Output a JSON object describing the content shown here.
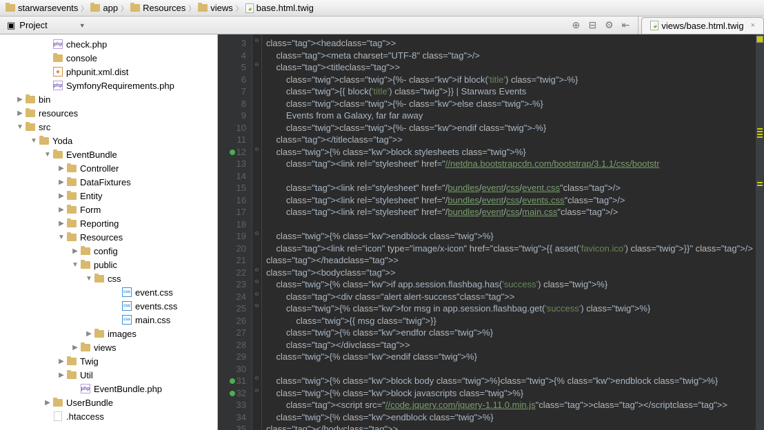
{
  "breadcrumb": [
    {
      "label": "starwarsevents",
      "type": "folder"
    },
    {
      "label": "app",
      "type": "folder"
    },
    {
      "label": "Resources",
      "type": "folder"
    },
    {
      "label": "views",
      "type": "folder"
    },
    {
      "label": "base.html.twig",
      "type": "twig"
    }
  ],
  "toolbar": {
    "project": "Project"
  },
  "tab": {
    "title": "views/base.html.twig"
  },
  "tree": [
    {
      "indent": 3,
      "arrow": "",
      "icon": "php",
      "label": "check.php"
    },
    {
      "indent": 3,
      "arrow": "",
      "icon": "folder",
      "label": "console"
    },
    {
      "indent": 3,
      "arrow": "",
      "icon": "xml",
      "label": "phpunit.xml.dist"
    },
    {
      "indent": 3,
      "arrow": "",
      "icon": "php",
      "label": "SymfonyRequirements.php"
    },
    {
      "indent": 1,
      "arrow": "▶",
      "icon": "folder",
      "label": "bin"
    },
    {
      "indent": 1,
      "arrow": "▶",
      "icon": "folder",
      "label": "resources"
    },
    {
      "indent": 1,
      "arrow": "▼",
      "icon": "folder",
      "label": "src"
    },
    {
      "indent": 2,
      "arrow": "▼",
      "icon": "folder",
      "label": "Yoda"
    },
    {
      "indent": 3,
      "arrow": "▼",
      "icon": "folder",
      "label": "EventBundle"
    },
    {
      "indent": 4,
      "arrow": "▶",
      "icon": "folder",
      "label": "Controller"
    },
    {
      "indent": 4,
      "arrow": "▶",
      "icon": "folder",
      "label": "DataFixtures"
    },
    {
      "indent": 4,
      "arrow": "▶",
      "icon": "folder",
      "label": "Entity"
    },
    {
      "indent": 4,
      "arrow": "▶",
      "icon": "folder",
      "label": "Form"
    },
    {
      "indent": 4,
      "arrow": "▶",
      "icon": "folder",
      "label": "Reporting"
    },
    {
      "indent": 4,
      "arrow": "▼",
      "icon": "folder",
      "label": "Resources"
    },
    {
      "indent": 5,
      "arrow": "▶",
      "icon": "folder",
      "label": "config"
    },
    {
      "indent": 5,
      "arrow": "▼",
      "icon": "folder",
      "label": "public"
    },
    {
      "indent": 6,
      "arrow": "▼",
      "icon": "folder",
      "label": "css"
    },
    {
      "indent": 8,
      "arrow": "",
      "icon": "css",
      "label": "event.css"
    },
    {
      "indent": 8,
      "arrow": "",
      "icon": "css",
      "label": "events.css"
    },
    {
      "indent": 8,
      "arrow": "",
      "icon": "css",
      "label": "main.css"
    },
    {
      "indent": 6,
      "arrow": "▶",
      "icon": "folder",
      "label": "images"
    },
    {
      "indent": 5,
      "arrow": "▶",
      "icon": "folder",
      "label": "views"
    },
    {
      "indent": 4,
      "arrow": "▶",
      "icon": "folder",
      "label": "Twig"
    },
    {
      "indent": 4,
      "arrow": "▶",
      "icon": "folder",
      "label": "Util"
    },
    {
      "indent": 5,
      "arrow": "",
      "icon": "php",
      "label": "EventBundle.php"
    },
    {
      "indent": 3,
      "arrow": "▶",
      "icon": "folder",
      "label": "UserBundle"
    },
    {
      "indent": 3,
      "arrow": "",
      "icon": "file",
      "label": ".htaccess"
    }
  ],
  "lines": {
    "start": 3,
    "end": 35
  },
  "code": {
    "l3": "<head>",
    "l4": "    <meta charset=\"UTF-8\" />",
    "l5": "    <title>",
    "l6": "        {%- if block('title') -%}",
    "l7": "        {{ block('title') }} | Starwars Events",
    "l8": "        {%- else -%}",
    "l9": "        Events from a Galaxy, far far away",
    "l10": "        {%- endif -%}",
    "l11": "    </title>",
    "l12": "    {% block stylesheets %}",
    "l13": "        <link rel=\"stylesheet\" href=\"//netdna.bootstrapcdn.com/bootstrap/3.1.1/css/bootstr",
    "l14": "",
    "l15": "        <link rel=\"stylesheet\" href=\"/bundles/event/css/event.css\"/>",
    "l16": "        <link rel=\"stylesheet\" href=\"/bundles/event/css/events.css\"/>",
    "l17": "        <link rel=\"stylesheet\" href=\"/bundles/event/css/main.css\"/>",
    "l18": "",
    "l19": "    {% endblock %}",
    "l20": "    <link rel=\"icon\" type=\"image/x-icon\" href=\"{{ asset('favicon.ico') }}\" />",
    "l21": "</head>",
    "l22": "<body>",
    "l23": "    {% if app.session.flashbag.has('success') %}",
    "l24": "        <div class=\"alert alert-success\">",
    "l25": "        {% for msg in app.session.flashbag.get('success') %}",
    "l26": "            {{ msg }}",
    "l27": "        {% endfor %}",
    "l28": "        </div>",
    "l29": "    {% endif %}",
    "l30": "",
    "l31": "    {% block body %}{% endblock %}",
    "l32": "    {% block javascripts %}",
    "l33": "        <script src=\"//code.jquery.com/jquery-1.11.0.min.js\"></script>",
    "l34": "    {% endblock %}",
    "l35": "</body>"
  }
}
